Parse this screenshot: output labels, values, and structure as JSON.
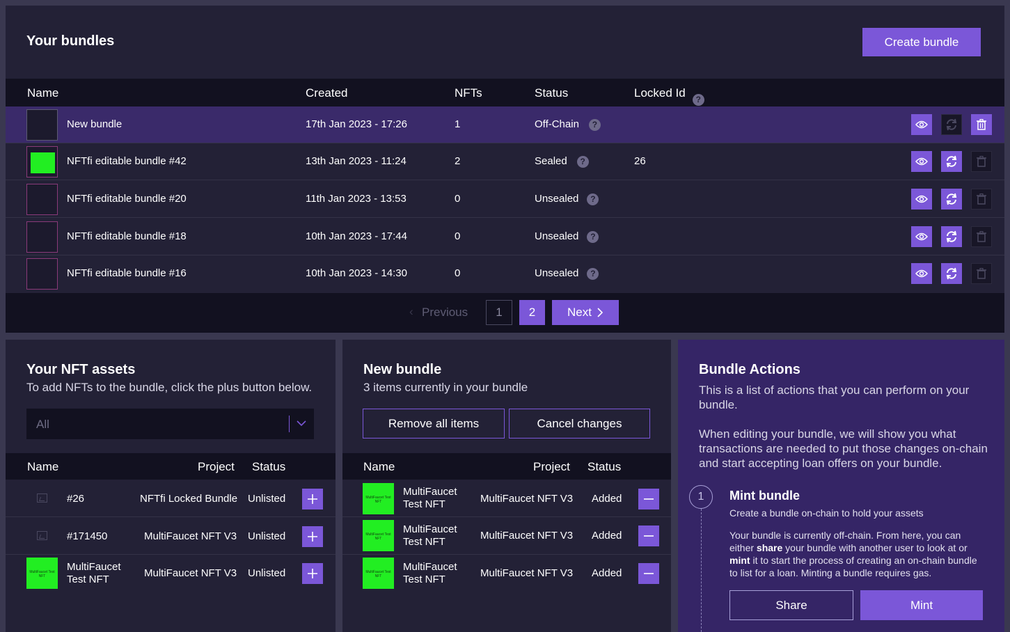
{
  "bundles": {
    "title": "Your bundles",
    "create_label": "Create bundle",
    "columns": {
      "name": "Name",
      "created": "Created",
      "nfts": "NFTs",
      "status": "Status",
      "locked_id": "Locked Id"
    },
    "rows": [
      {
        "name": "New bundle",
        "created": "17th Jan 2023 - 17:26",
        "nfts": "1",
        "status": "Off-Chain",
        "locked_id": ""
      },
      {
        "name": "NFTfi editable bundle #42",
        "created": "13th Jan 2023 - 11:24",
        "nfts": "2",
        "status": "Sealed",
        "locked_id": "26"
      },
      {
        "name": "NFTfi editable bundle #20",
        "created": "11th Jan 2023 - 13:53",
        "nfts": "0",
        "status": "Unsealed",
        "locked_id": ""
      },
      {
        "name": "NFTfi editable bundle #18",
        "created": "10th Jan 2023 - 17:44",
        "nfts": "0",
        "status": "Unsealed",
        "locked_id": ""
      },
      {
        "name": "NFTfi editable bundle #16",
        "created": "10th Jan 2023 - 14:30",
        "nfts": "0",
        "status": "Unsealed",
        "locked_id": ""
      }
    ],
    "pagination": {
      "previous": "Previous",
      "pages": [
        "1",
        "2"
      ],
      "next": "Next"
    }
  },
  "assets": {
    "title": "Your NFT assets",
    "subtitle": "To add NFTs to the bundle, click the plus button below.",
    "filter_value": "All",
    "columns": {
      "name": "Name",
      "project": "Project",
      "status": "Status"
    },
    "rows": [
      {
        "name": "#26",
        "project": "NFTfi Locked Bundle",
        "status": "Unlisted"
      },
      {
        "name": "#171450",
        "project": "MultiFaucet NFT V3",
        "status": "Unlisted"
      },
      {
        "name_line1": "MultiFaucet",
        "name_line2": "Test NFT",
        "project": "MultiFaucet NFT V3",
        "status": "Unlisted"
      }
    ]
  },
  "new_bundle": {
    "title": "New bundle",
    "subtitle": "3 items currently in your bundle",
    "remove_label": "Remove all items",
    "cancel_label": "Cancel changes",
    "columns": {
      "name": "Name",
      "project": "Project",
      "status": "Status"
    },
    "rows": [
      {
        "name_line1": "MultiFaucet",
        "name_line2": "Test NFT",
        "project": "MultiFaucet NFT V3",
        "status": "Added"
      },
      {
        "name_line1": "MultiFaucet",
        "name_line2": "Test NFT",
        "project": "MultiFaucet NFT V3",
        "status": "Added"
      },
      {
        "name_line1": "MultiFaucet",
        "name_line2": "Test NFT",
        "project": "MultiFaucet NFT V3",
        "status": "Added"
      }
    ],
    "thumb_text": "MultiFaucet Test NFT"
  },
  "actions": {
    "title": "Bundle Actions",
    "intro": "This is a list of actions that you can perform on your bundle.",
    "intro2": "When editing your bundle, we will show you what transactions are needed to put those changes on-chain and start accepting loan offers on your bundle.",
    "step_number": "1",
    "step_title": "Mint bundle",
    "step_subtitle": "Create a bundle on-chain to hold your assets",
    "step_body_1": "Your bundle is currently off-chain. From here, you can either ",
    "step_body_share": "share",
    "step_body_2": " your bundle with another user to look at or ",
    "step_body_mint": "mint",
    "step_body_3": " it to start the process of creating an on-chain bundle to list for a loan. Minting a bundle requires gas.",
    "share_label": "Share",
    "mint_label": "Mint"
  },
  "colors": {
    "accent": "#7b57d8",
    "panel": "#232136",
    "header": "#121120",
    "actions_panel": "#352566"
  },
  "icons": [
    "eye-icon",
    "refresh-icon",
    "trash-icon",
    "question-icon",
    "plus-icon",
    "minus-icon",
    "chevron-down-icon",
    "chevron-right-icon",
    "image-placeholder-icon"
  ]
}
